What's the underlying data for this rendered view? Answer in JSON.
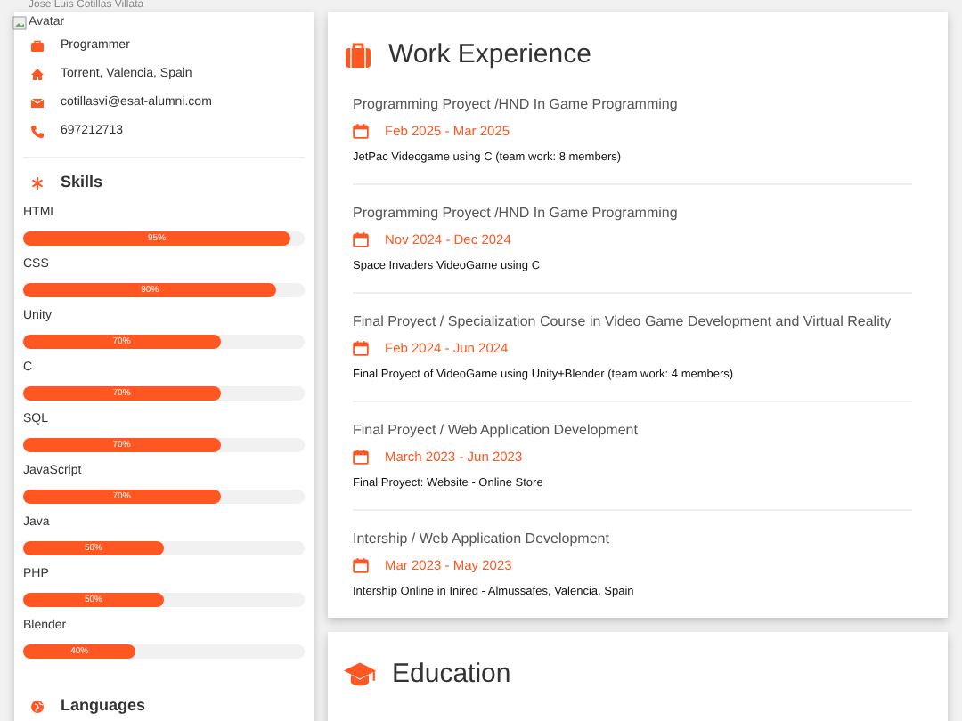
{
  "header": {
    "name": "Jose Luis Cotillas Villata"
  },
  "profile": {
    "avatar_alt": "Avatar",
    "info": [
      {
        "kind": "job",
        "text": "Programmer"
      },
      {
        "kind": "home",
        "text": "Torrent, Valencia, Spain"
      },
      {
        "kind": "email",
        "text": "cotillasvi@esat-alumni.com"
      },
      {
        "kind": "phone",
        "text": "697212713"
      }
    ]
  },
  "skills": {
    "title": "Skills",
    "items": [
      {
        "name": "HTML",
        "level": 0.95,
        "reading": "95%"
      },
      {
        "name": "CSS",
        "level": 0.9,
        "reading": "90%"
      },
      {
        "name": "Unity",
        "level": 0.7,
        "reading": "70%"
      },
      {
        "name": "C",
        "level": 0.7,
        "reading": "70%"
      },
      {
        "name": "SQL",
        "level": 0.7,
        "reading": "70%"
      },
      {
        "name": "JavaScript",
        "level": 0.7,
        "reading": "70%"
      },
      {
        "name": "Java",
        "level": 0.5,
        "reading": "50%"
      },
      {
        "name": "PHP",
        "level": 0.5,
        "reading": "50%"
      },
      {
        "name": "Blender",
        "level": 0.4,
        "reading": "40%"
      }
    ]
  },
  "languages": {
    "title": "Languages"
  },
  "work": {
    "title": "Work Experience",
    "entries": [
      {
        "title": "Programming Proyect /HND In Game Programming",
        "date": "Feb 2025 - Mar 2025",
        "description": "JetPac Videogame using C (team work: 8 members)"
      },
      {
        "title": "Programming Proyect /HND In Game Programming",
        "date": "Nov 2024 - Dec 2024",
        "description": "Space Invaders VideoGame using C"
      },
      {
        "title": "Final Proyect / Specialization Course in Video Game Development and Virtual Reality",
        "date": "Feb 2024 - Jun 2024",
        "description": "Final Proyect of VideoGame using Unity+Blender (team work: 4 members)"
      },
      {
        "title": "Final Proyect / Web Application Development",
        "date": "March 2023 - Jun 2023",
        "description": "Final Proyect: Website - Online Store"
      },
      {
        "title": "Intership / Web Application Development",
        "date": "Mar 2023 - May 2023",
        "description": "Intership Online in Inired - Almussafes, Valencia, Spain"
      }
    ]
  },
  "education": {
    "title": "Education"
  }
}
